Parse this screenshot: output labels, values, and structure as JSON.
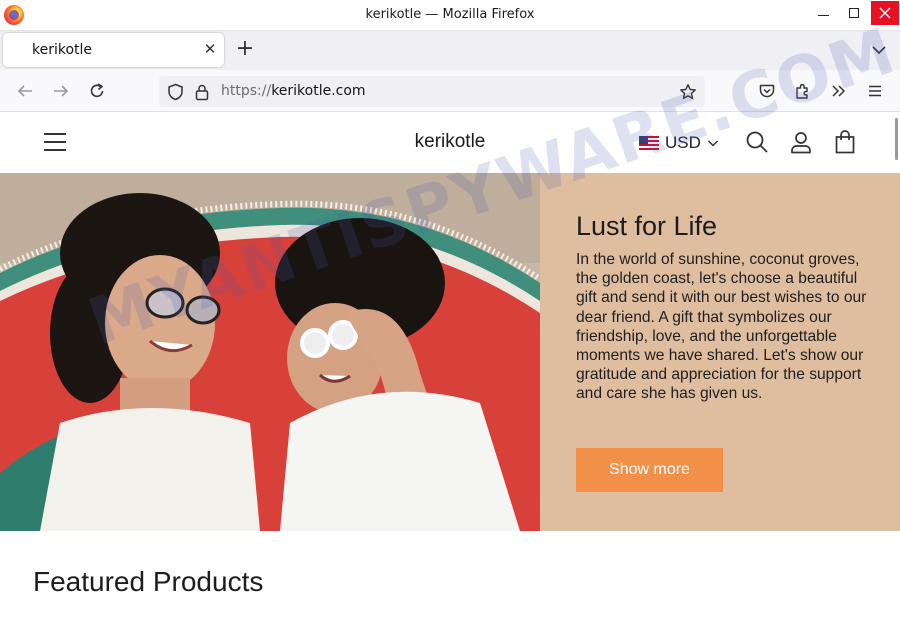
{
  "window": {
    "title": "kerikotle — Mozilla Firefox",
    "app_icon": "firefox-icon"
  },
  "tabs": [
    {
      "title": "kerikotle",
      "active": true
    }
  ],
  "navbar": {
    "url_scheme": "https://",
    "url_host": "kerikotle.com",
    "icons": [
      "back-arrow-icon",
      "forward-arrow-icon",
      "reload-icon",
      "shield-icon",
      "lock-icon",
      "star-icon",
      "pocket-icon",
      "extensions-icon",
      "overflow-chevrons-icon",
      "menu-icon"
    ]
  },
  "site": {
    "logo": "kerikotle",
    "currency": "USD",
    "header_icons": [
      "hamburger-icon",
      "us-flag-icon",
      "search-icon",
      "account-icon",
      "cart-bag-icon"
    ]
  },
  "hero": {
    "title": "Lust for Life",
    "text": "In the world of sunshine, coconut groves, the golden coast, let's choose a beautiful gift and send it with our best wishes to our dear friend. A gift that symbolizes our friendship, love, and the unforgettable moments we have shared. Let's show our gratitude and appreciation for the support and care she has given us.",
    "button": "Show more",
    "panel_color": "#dfbea0",
    "button_color": "#f29049"
  },
  "featured": {
    "title": "Featured Products"
  },
  "watermark": "MYANTISPYWARE.COM"
}
